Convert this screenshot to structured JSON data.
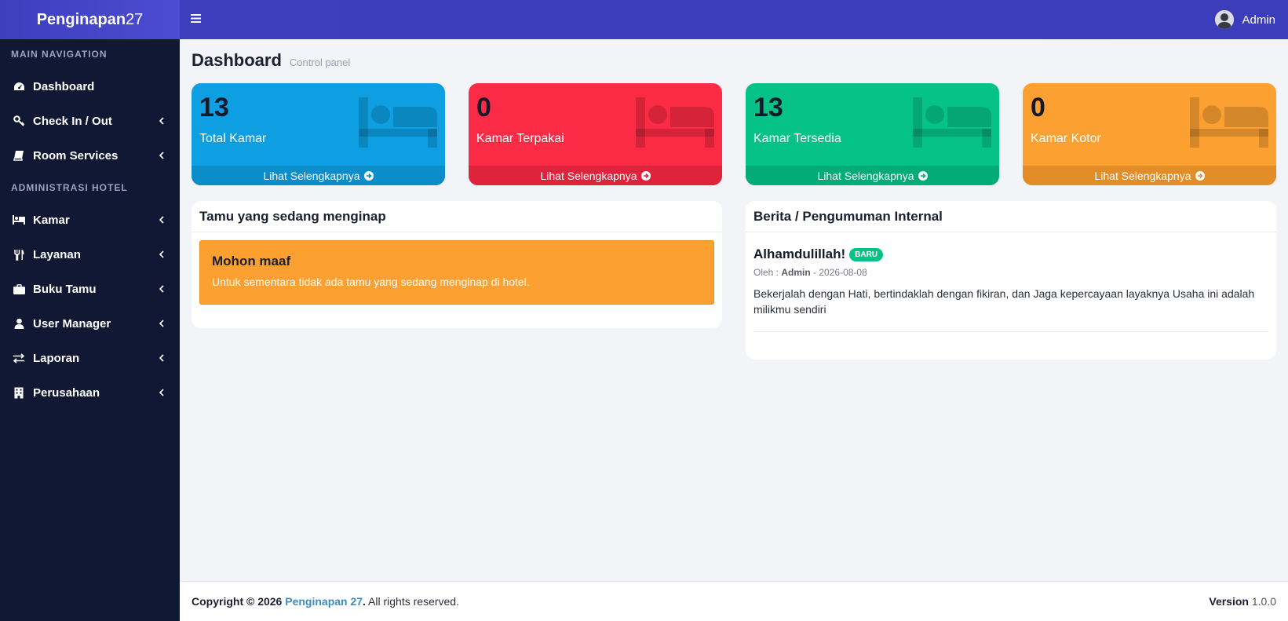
{
  "brand": {
    "name_bold": "Penginapan",
    "name_light": "27"
  },
  "sidebar": {
    "header_main": "MAIN NAVIGATION",
    "header_admin": "ADMINISTRASI HOTEL",
    "items_main": [
      {
        "label": "Dashboard",
        "icon": "dashboard-icon"
      },
      {
        "label": "Check In / Out",
        "icon": "key-icon"
      },
      {
        "label": "Room Services",
        "icon": "book-icon"
      }
    ],
    "items_admin": [
      {
        "label": "Kamar",
        "icon": "bed-icon"
      },
      {
        "label": "Layanan",
        "icon": "cutlery-icon"
      },
      {
        "label": "Buku Tamu",
        "icon": "briefcase-icon"
      },
      {
        "label": "User Manager",
        "icon": "user-icon"
      },
      {
        "label": "Laporan",
        "icon": "exchange-icon"
      },
      {
        "label": "Perusahaan",
        "icon": "building-icon"
      }
    ]
  },
  "topbar": {
    "user_name": "Admin"
  },
  "page": {
    "title": "Dashboard",
    "subtitle": "Control panel"
  },
  "stats": [
    {
      "value": "13",
      "label": "Total Kamar",
      "link": "Lihat Selengkapnya",
      "color": "#0d9fe1"
    },
    {
      "value": "0",
      "label": "Kamar Terpakai",
      "link": "Lihat Selengkapnya",
      "color": "#fb2a45"
    },
    {
      "value": "13",
      "label": "Kamar Tersedia",
      "link": "Lihat Selengkapnya",
      "color": "#05c386"
    },
    {
      "value": "0",
      "label": "Kamar Kotor",
      "link": "Lihat Selengkapnya",
      "color": "#fba031"
    }
  ],
  "guests": {
    "title": "Tamu yang sedang menginap",
    "alert_title": "Mohon maaf",
    "alert_text": "Untuk sementara tidak ada tamu yang sedang menginap di hotel."
  },
  "news": {
    "title": "Berita / Pengumuman Internal",
    "item_title": "Alhamdulillah!",
    "badge": "BARU",
    "meta_prefix": "Oleh : ",
    "author": "Admin",
    "date_sep": " - ",
    "date": "2026-08-08",
    "body": "Bekerjalah dengan Hati, bertindaklah dengan fikiran, dan Jaga kepercayaan layaknya Usaha ini adalah milikmu sendiri"
  },
  "footer": {
    "copyright": "Copyright © 2026",
    "brand": "Penginapan 27",
    "dot": ".",
    "rights": " All rights reserved.",
    "version_label": "Version",
    "version": "1.0.0"
  }
}
